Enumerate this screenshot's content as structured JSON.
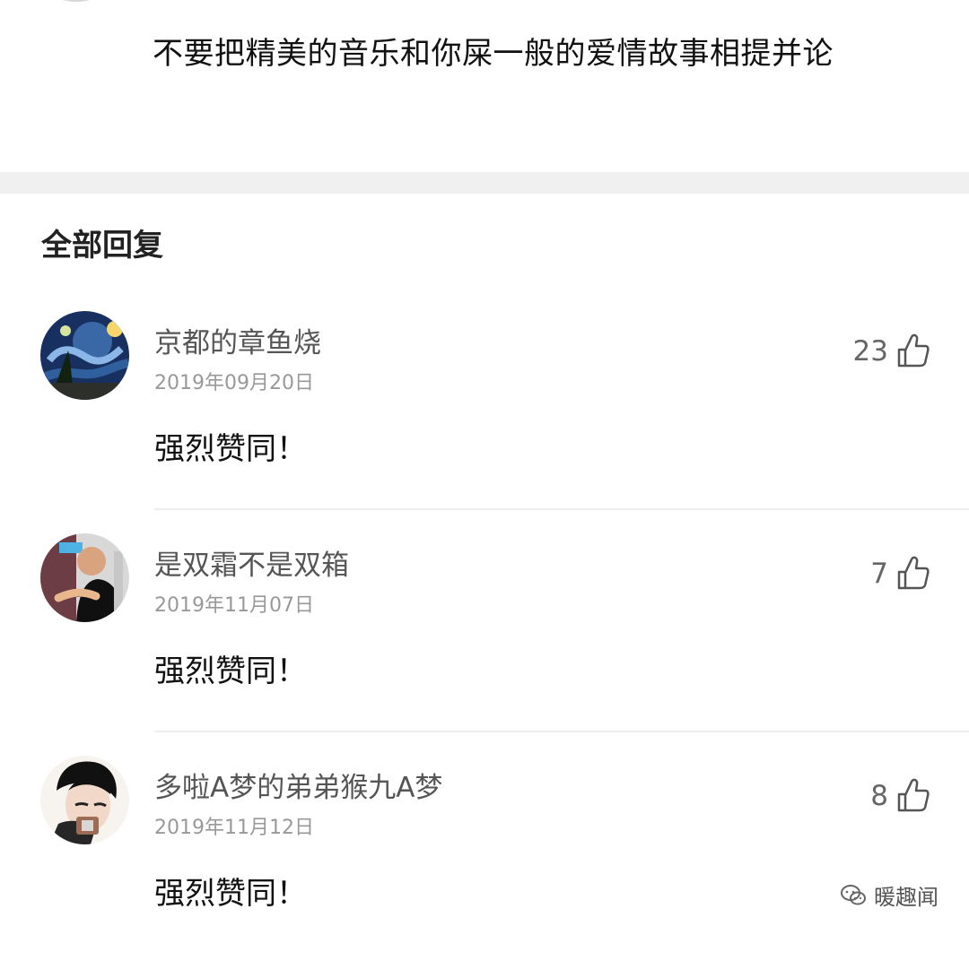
{
  "original_comment": {
    "text": "不要把精美的音乐和你屎一般的爱情故事相提并论"
  },
  "replies_section": {
    "title": "全部回复",
    "items": [
      {
        "username": "京都的章鱼烧",
        "date": "2019年09月20日",
        "likes": "23",
        "text": "强烈赞同！",
        "avatar": "starry-night-avatar"
      },
      {
        "username": "是双霜不是双箱",
        "date": "2019年11月07日",
        "likes": "7",
        "text": "强烈赞同！",
        "avatar": "photo-avatar"
      },
      {
        "username": "多啦A梦的弟弟猴九A梦",
        "date": "2019年11月12日",
        "likes": "8",
        "text": "强烈赞同！",
        "avatar": "cartoon-avatar"
      }
    ]
  },
  "watermark": {
    "text": "暖趣闻",
    "icon": "wechat-icon"
  },
  "colors": {
    "divider": "#f0f0f0",
    "username": "#555555",
    "date": "#999999"
  }
}
